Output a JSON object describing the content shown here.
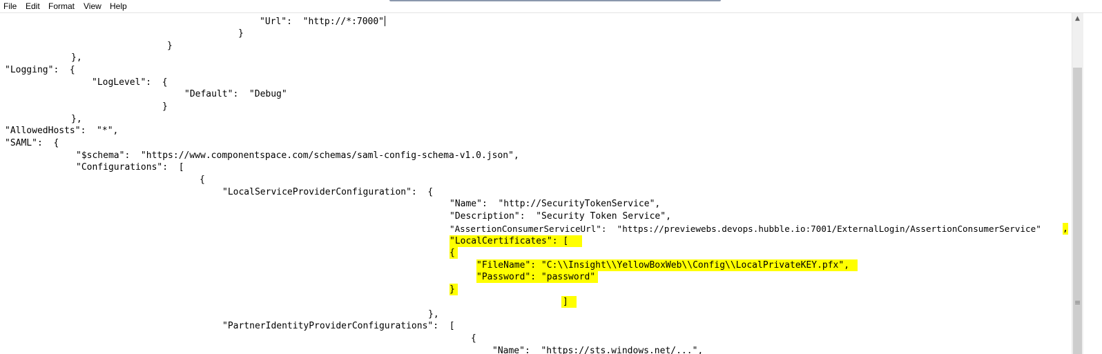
{
  "menu": {
    "file": "File",
    "edit": "Edit",
    "format": "Format",
    "view": "View",
    "help": "Help"
  },
  "editor": {
    "lines": [
      "\"Url\":  \"http://*:7000\"",
      "}",
      "}",
      "},",
      "\"Logging\":  {",
      "\"LogLevel\":  {",
      "\"Default\":  \"Debug\"",
      "}",
      "},",
      "\"AllowedHosts\":  \"*\",",
      "\"SAML\":  {",
      "\"$schema\":  \"https://www.componentspace.com/schemas/saml-config-schema-v1.0.json\",",
      "\"Configurations\":  [",
      "{",
      "\"LocalServiceProviderConfiguration\":  {",
      "\"Name\":  \"http://SecurityTokenService\",",
      "\"Description\":  \"Security Token Service\",",
      "\"AssertionConsumerServiceUrl\":  \"https://previewebs.devops.hubble.io:7001/ExternalLogin/AssertionConsumerService\"",
      ",",
      "\"LocalCertificates\": [",
      "{",
      "\"FileName\": \"C:\\\\Insight\\\\YellowBoxWeb\\\\Config\\\\LocalPrivateKEY.pfx\",",
      "\"Password\": \"password\"",
      "}",
      "]",
      "},",
      "\"PartnerIdentityProviderConfigurations\":  [",
      "{",
      "\"Name\":  \"https://sts.windows.net/...\","
    ]
  },
  "colors": {
    "highlight": "#ffff00",
    "text": "#000000",
    "background": "#ffffff",
    "scrollbar_thumb": "#cdcdcd"
  },
  "icons": {
    "scroll_up": "chevron-up-icon",
    "grip": "grip-icon"
  }
}
